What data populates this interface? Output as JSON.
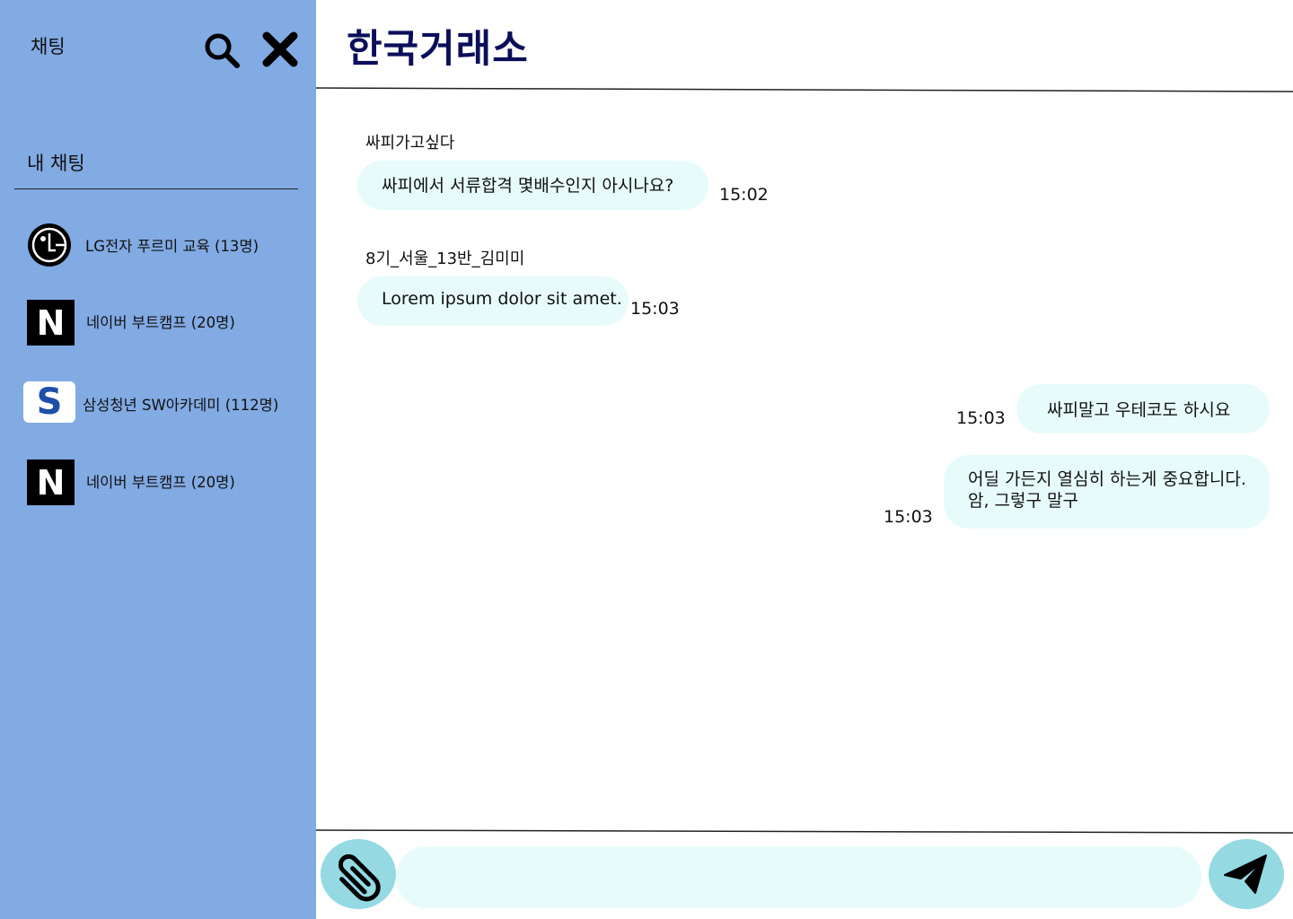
{
  "sidebar": {
    "title": "채팅",
    "section_title": "내 채팅",
    "search_icon": "search-icon",
    "close_icon": "close-icon",
    "rooms": [
      {
        "logo": "lg-logo",
        "name": "LG전자 푸르미 교육 (13명)"
      },
      {
        "logo": "naver-logo",
        "logo_text": "N",
        "name": "네이버 부트캠프 (20명)"
      },
      {
        "logo": "samsung-s-logo",
        "logo_text": "S",
        "name": "삼성청년 SW아카데미  (112명)"
      },
      {
        "logo": "naver-logo",
        "logo_text": "N",
        "name": "네이버 부트캠프 (20명)"
      }
    ]
  },
  "header": {
    "title": "한국거래소"
  },
  "messages": [
    {
      "direction": "incoming",
      "sender": "싸피가고싶다",
      "text": "싸피에서 서류합격 몇배수인지 아시나요?",
      "time": "15:02"
    },
    {
      "direction": "incoming",
      "sender": "8기_서울_13반_김미미",
      "text": "Lorem ipsum dolor sit amet.",
      "time": "15:03"
    },
    {
      "direction": "outgoing",
      "text": "싸피말고 우테코도 하시요",
      "time": "15:03"
    },
    {
      "direction": "outgoing",
      "lines": [
        "어딜 가든지 열심히 하는게 중요합니다.",
        "암, 그렇구 말구"
      ],
      "time": "15:03"
    }
  ],
  "composer": {
    "value": "",
    "placeholder": "",
    "attach_icon": "paperclip-icon",
    "send_icon": "paper-plane-icon"
  },
  "colors": {
    "sidebar_bg": "#82aae3",
    "title_color": "#0b0f5a",
    "bubble_bg": "#e8fbfb",
    "button_bg": "#95d9e3"
  }
}
